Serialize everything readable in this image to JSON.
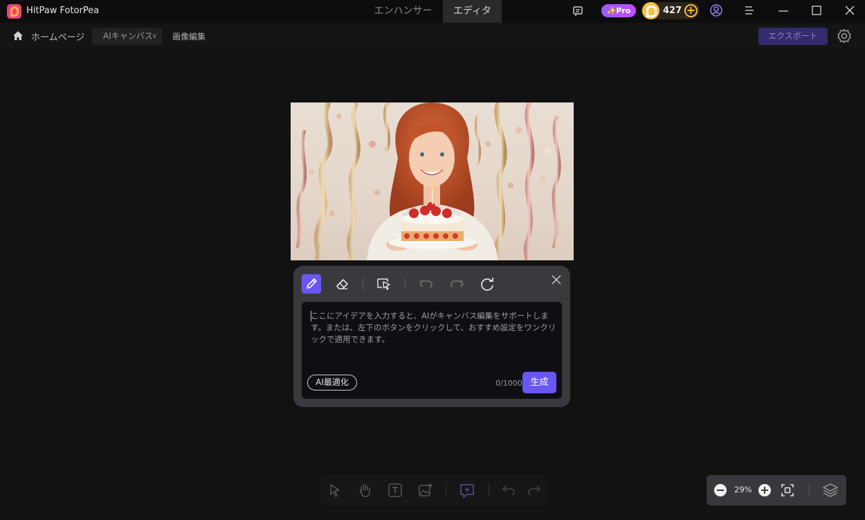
{
  "app": {
    "title": "HitPaw FotorPea"
  },
  "mode_tabs": [
    {
      "label": "エンハンサー",
      "active": false
    },
    {
      "label": "エディタ",
      "active": true
    }
  ],
  "header": {
    "pro_label": "✨Pro",
    "credits": "427"
  },
  "subbar": {
    "home_label": "ホームページ",
    "mode_select": "AIキャンバス",
    "breadcrumb": "画像編集",
    "export_label": "エクスポート"
  },
  "ai_panel": {
    "placeholder": "ここにアイデアを入力すると、AIがキャンバス編集をサポートします。または、左下のボタンをクリックして、おすすめ設定をワンクリックで適用できます。",
    "ai_optimize_label": "AI最適化",
    "char_count": "0/1000",
    "generate_label": "生成"
  },
  "zoom": {
    "value": "29%"
  },
  "colors": {
    "accent": "#6a57f3",
    "pro_gradient_start": "#9a5cff",
    "coin": "#f6c244"
  }
}
